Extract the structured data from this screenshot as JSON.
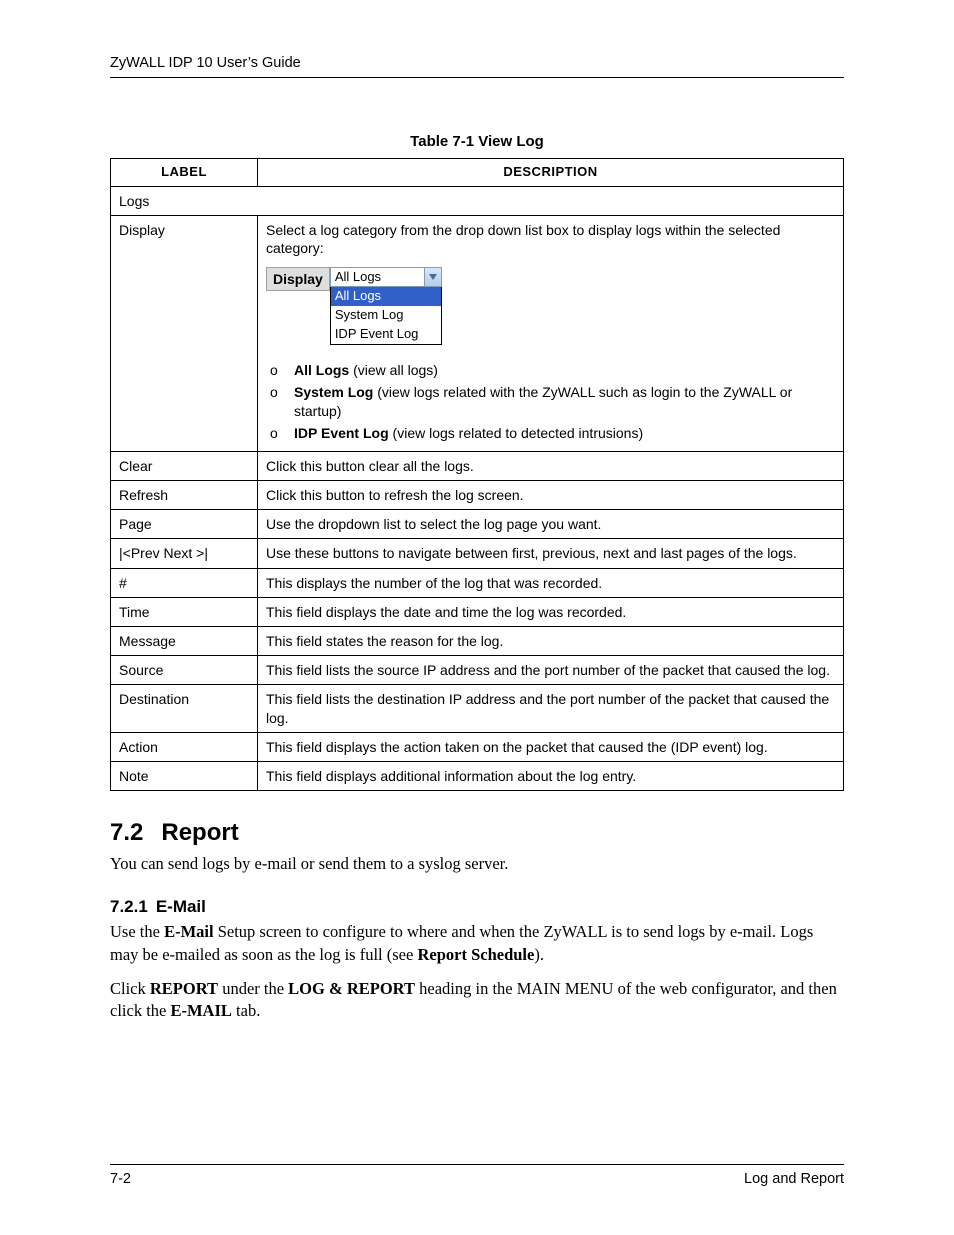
{
  "header": {
    "running_title": "ZyWALL IDP 10 User’s Guide"
  },
  "table": {
    "caption": "Table 7-1 View Log",
    "headers": {
      "label": "LABEL",
      "description": "DESCRIPTION"
    },
    "logs_row_label": "Logs",
    "display": {
      "label": "Display",
      "intro": "Select a log category from the drop down list box to display logs within the selected category:",
      "dropdown": {
        "lbl": "Display",
        "current": "All Logs",
        "options": [
          "All Logs",
          "System Log",
          "IDP Event Log"
        ]
      },
      "bullets": [
        {
          "bold": "All Logs",
          "rest": " (view all logs)"
        },
        {
          "bold": "System Log",
          "rest": " (view logs related with the ZyWALL such as login to the ZyWALL or startup)"
        },
        {
          "bold": "IDP Event Log",
          "rest": " (view logs related to detected intrusions)"
        }
      ]
    },
    "rows": [
      {
        "label": "Clear",
        "desc": "Click this button clear all the logs."
      },
      {
        "label": "Refresh",
        "desc": "Click this button to refresh the log screen."
      },
      {
        "label": "Page",
        "desc": "Use the dropdown list to select the log page you want."
      },
      {
        "label": "|<Prev   Next >|",
        "desc": "Use these buttons to navigate between first, previous, next and last pages of the logs."
      },
      {
        "label": "#",
        "desc": "This displays the number of the log that was recorded."
      },
      {
        "label": "Time",
        "desc": "This field displays the date and time the log was recorded."
      },
      {
        "label": "Message",
        "desc": "This field states the reason for the log."
      },
      {
        "label": "Source",
        "desc": "This field lists the source IP address and the port number of the packet that caused the log."
      },
      {
        "label": "Destination",
        "desc": "This field lists the destination IP address and the port number of the packet that caused the log."
      },
      {
        "label": "Action",
        "desc": "This field displays the action taken on the packet that caused the (IDP event) log."
      },
      {
        "label": "Note",
        "desc": "This field displays additional information about the log entry."
      }
    ]
  },
  "section": {
    "h2_num": "7.2",
    "h2_title": "Report",
    "p1": "You can send logs by e-mail or send them to a syslog server.",
    "h3_num": "7.2.1",
    "h3_title": "E-Mail",
    "p2_parts": {
      "a": "Use the ",
      "b": "E-Mail",
      "c": " Setup screen to configure to where and when the ZyWALL is to send logs by e-mail. Logs may be e-mailed as soon as the log is full (see ",
      "d": "Report Schedule",
      "e": ")."
    },
    "p3_parts": {
      "a": "Click ",
      "b": "REPORT",
      "c": " under the ",
      "d": "LOG & REPORT",
      "e": " heading in the MAIN MENU of the web configurator, and then click the ",
      "f": "E-MAIL",
      "g": " tab."
    }
  },
  "footer": {
    "left": "7-2",
    "right": "Log and Report"
  }
}
